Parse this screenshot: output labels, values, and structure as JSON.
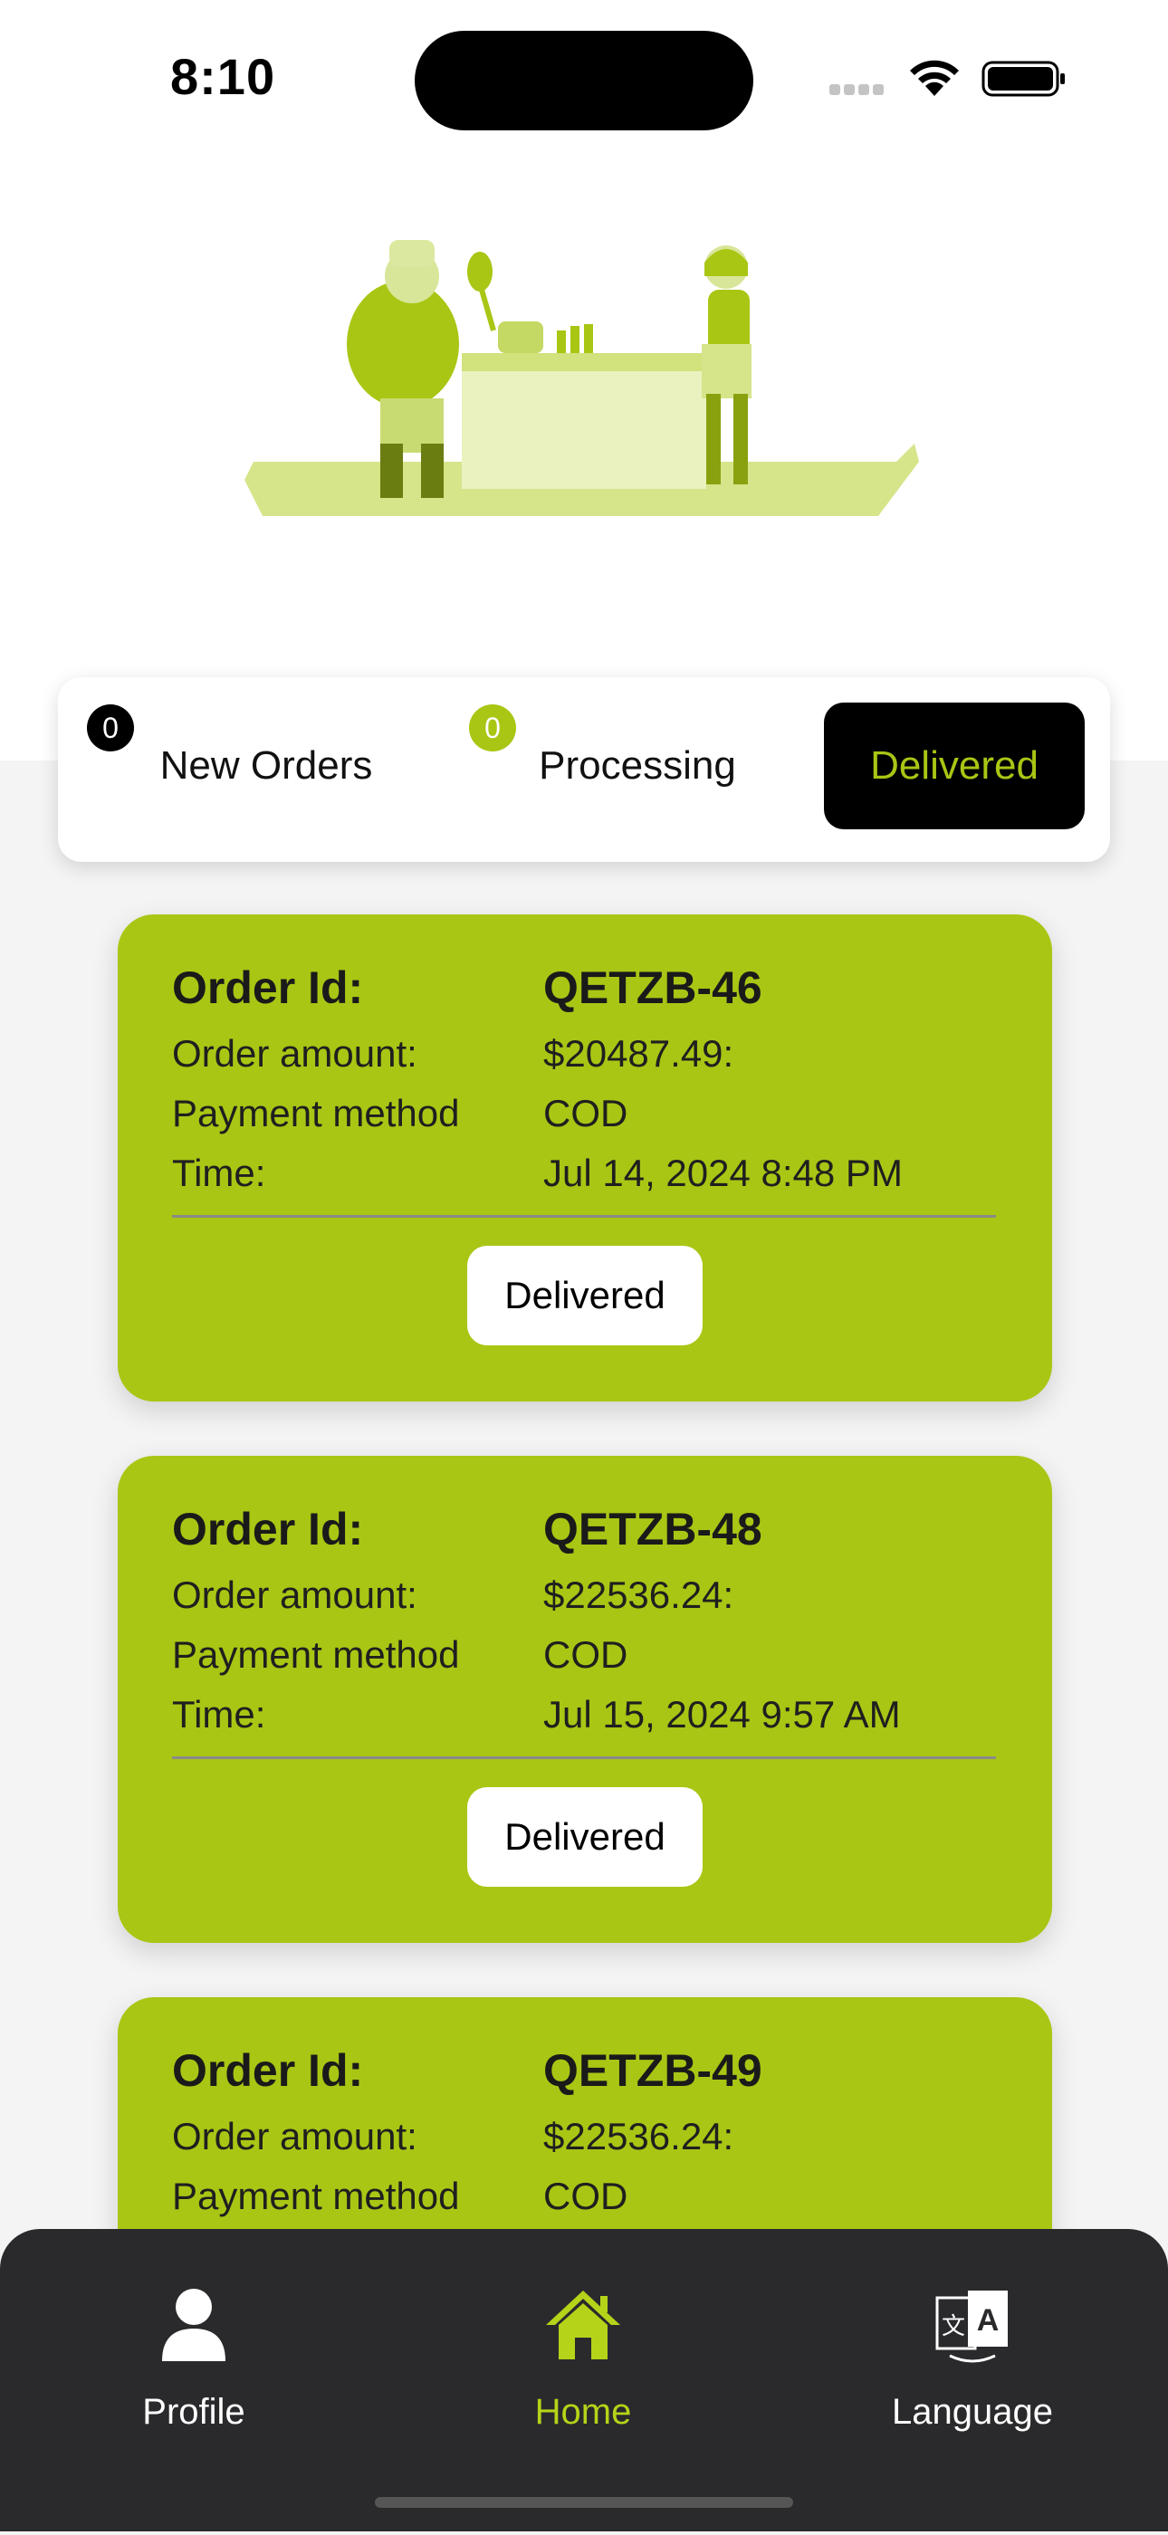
{
  "status_bar": {
    "time": "8:10"
  },
  "tabs": [
    {
      "label": "New Orders",
      "badge": "0"
    },
    {
      "label": "Processing",
      "badge": "0"
    },
    {
      "label": "Delivered",
      "active": true
    }
  ],
  "orders": [
    {
      "id_label": "Order Id:",
      "id": "QETZB-46",
      "amount_label": "Order amount:",
      "amount": "$20487.49:",
      "payment_label": "Payment method",
      "payment": "COD",
      "time_label": "Time:",
      "time": "Jul 14, 2024 8:48 PM",
      "status": "Delivered"
    },
    {
      "id_label": "Order Id:",
      "id": "QETZB-48",
      "amount_label": "Order amount:",
      "amount": "$22536.24:",
      "payment_label": "Payment method",
      "payment": "COD",
      "time_label": "Time:",
      "time": "Jul 15, 2024 9:57 AM",
      "status": "Delivered"
    },
    {
      "id_label": "Order Id:",
      "id": "QETZB-49",
      "amount_label": "Order amount:",
      "amount": "$22536.24:",
      "payment_label": "Payment method",
      "payment": "COD"
    }
  ],
  "bottom_nav": [
    {
      "label": "Profile",
      "icon": "person-icon"
    },
    {
      "label": "Home",
      "icon": "home-icon",
      "active": true
    },
    {
      "label": "Language",
      "icon": "translate-icon"
    }
  ],
  "colors": {
    "accent": "#a9c614",
    "nav_bg": "#2a2a2c",
    "active_nav": "#b5d319"
  }
}
